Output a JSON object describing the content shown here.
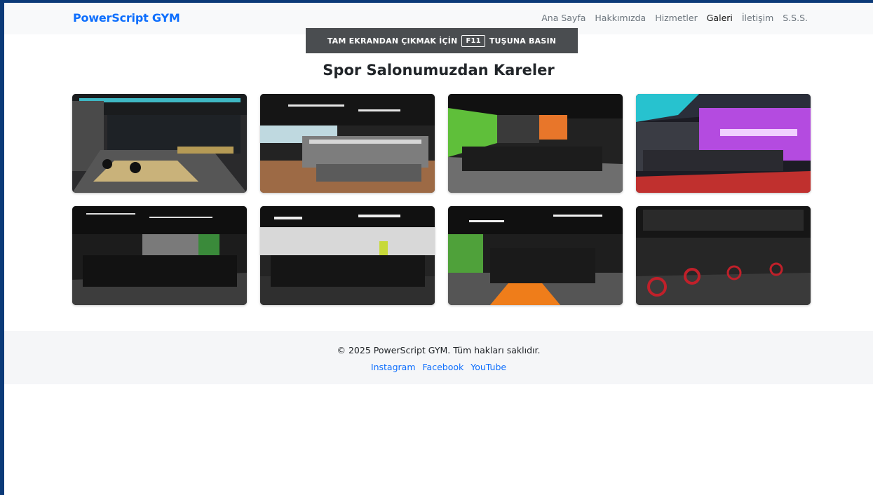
{
  "navbar": {
    "brand": "PowerScript GYM",
    "links": [
      {
        "label": "Ana Sayfa"
      },
      {
        "label": "Hakkımızda"
      },
      {
        "label": "Hizmetler"
      },
      {
        "label": "Galeri",
        "active": true
      },
      {
        "label": "İletişim"
      },
      {
        "label": "S.S.S."
      }
    ]
  },
  "fullscreen_banner": {
    "before": "TAM EKRANDAN ÇIKMAK İÇİN",
    "key": "F11",
    "after": "TUŞUNA BASIN"
  },
  "gallery": {
    "title": "Spor Salonumuzdan Kareler",
    "photos": [
      {
        "accent": "#3fb8c4"
      },
      {
        "accent": "#d6d6d6"
      },
      {
        "accent": "#5fbf3a"
      },
      {
        "accent": "#b44be0"
      },
      {
        "accent": "#7a7a7a"
      },
      {
        "accent": "#c7d93a"
      },
      {
        "accent": "#ef7d1a"
      },
      {
        "accent": "#c0202a"
      }
    ]
  },
  "footer": {
    "copyright": "© 2025 PowerScript GYM. Tüm hakları saklıdır.",
    "social": [
      "Instagram",
      "Facebook",
      "YouTube"
    ]
  },
  "colors": {
    "brand": "#0d6efd",
    "nav_bg": "#f8f9fa",
    "outer_bg": "#0b3a78"
  }
}
